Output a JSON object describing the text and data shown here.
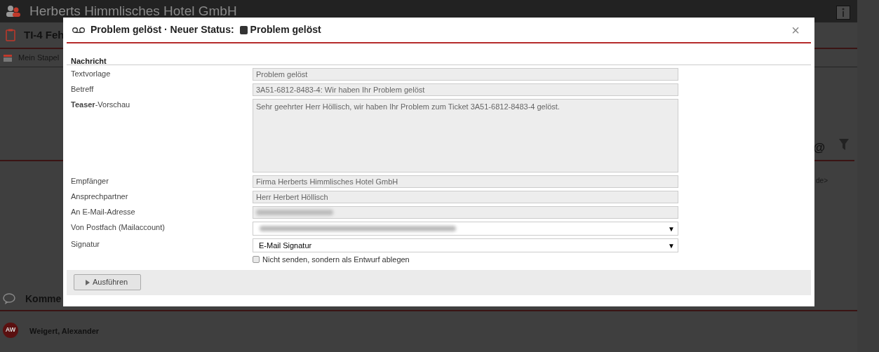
{
  "background": {
    "company": "Herberts Himmlisches Hotel GmbH",
    "ticket_title": "TI-4 Feh",
    "toolbar_item": "Mein Stapel",
    "side_fragment": "de>",
    "at_sign": "@",
    "comments_title": "Komme",
    "comment_author_initials": "AW",
    "comment_author": "Weigert, Alexander"
  },
  "dialog": {
    "title": "Problem gelöst · Neuer Status:",
    "status": {
      "label": "Problem gelöst",
      "color": "#333333"
    },
    "section": "Nachricht",
    "fields": [
      {
        "kind": "text",
        "label": "Textvorlage",
        "value": "Problem gelöst"
      },
      {
        "kind": "text",
        "label": "Betreff",
        "value": "3A51-6812-8483-4: Wir haben Ihr Problem gelöst"
      },
      {
        "kind": "textarea",
        "label": "**Teaser**-Vorschau",
        "value": "Sehr geehrter Herr Höllisch, wir haben Ihr Problem zum Ticket 3A51-6812-8483-4 gelöst."
      },
      {
        "kind": "text",
        "label": "Empfänger",
        "value": "Firma Herberts Himmlisches Hotel GmbH"
      },
      {
        "kind": "text",
        "label": "Ansprechpartner",
        "value": "Herr Herbert Höllisch"
      },
      {
        "kind": "blurred",
        "label": "An E-Mail-Adresse"
      },
      {
        "kind": "blurred-select",
        "label": "Von Postfach (Mailaccount)",
        "caret": "▼"
      },
      {
        "kind": "select",
        "label": "Signatur",
        "value": "E-Mail Signatur",
        "caret": "▼"
      }
    ],
    "checkbox": {
      "label": "Nicht senden, sondern als Entwurf ablegen",
      "checked": false
    },
    "run_button": "Ausführen",
    "close": "×"
  }
}
